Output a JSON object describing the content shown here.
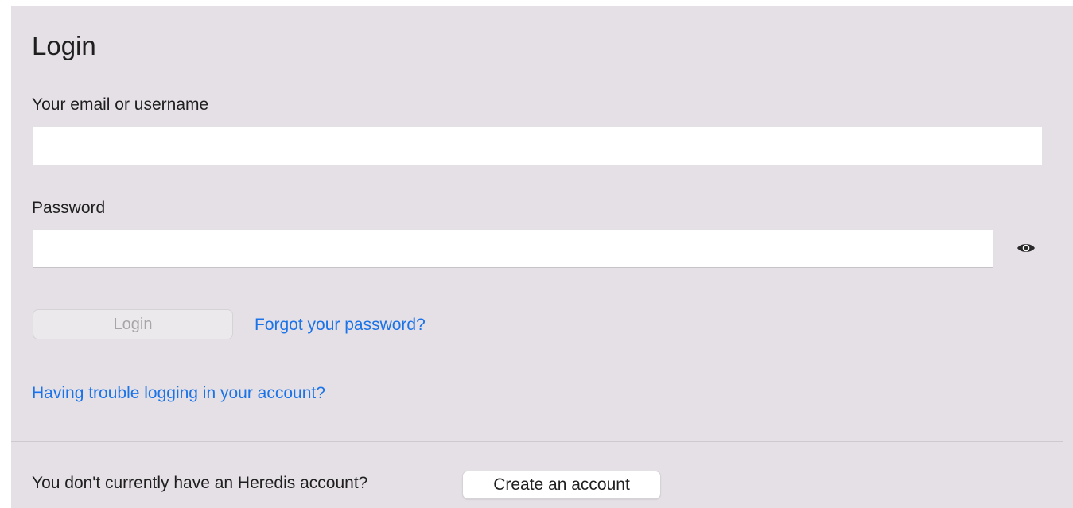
{
  "login": {
    "title": "Login",
    "email_label": "Your email or username",
    "email_value": "",
    "email_placeholder": "",
    "password_label": "Password",
    "password_value": "",
    "password_placeholder": "",
    "toggle_icon": "eye-icon",
    "login_button_label": "Login",
    "forgot_link": "Forgot your password?",
    "trouble_link": "Having trouble logging in your account?"
  },
  "footer": {
    "prompt": "You don't  currently have an Heredis account?",
    "create_button_label": "Create an account"
  },
  "colors": {
    "panel_background": "#e5e0e6",
    "link": "#1a73e8",
    "disabled_text": "#a7a5a8"
  }
}
